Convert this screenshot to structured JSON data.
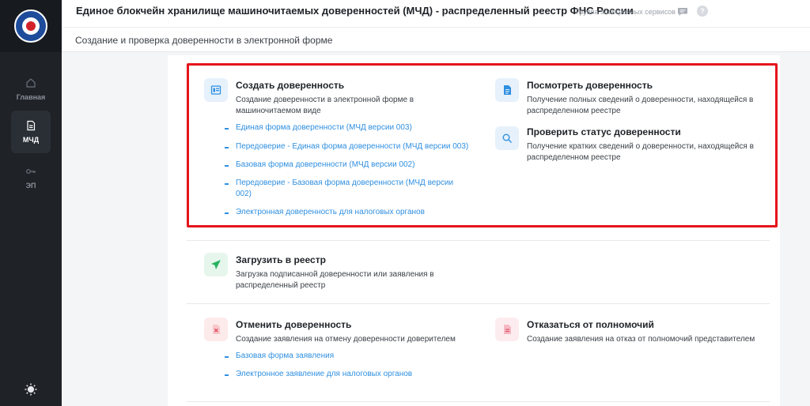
{
  "colors": {
    "accent": "#2f8fe0",
    "highlight": "#e5141b",
    "sidebar_bg": "#1f2328"
  },
  "sidebar": {
    "items": [
      {
        "label": "Главная",
        "icon": "home-icon"
      },
      {
        "label": "МЧД",
        "icon": "document-icon",
        "active": true
      },
      {
        "label": "ЭП",
        "icon": "key-icon"
      }
    ],
    "theme_toggle_icon": "sun-icon"
  },
  "header": {
    "title": "Единое блокчейн хранилище машиночитаемых доверенностей (МЧД) - распределенный реестр ФНС России",
    "group_link": "Группа электронных сервисов"
  },
  "page_title": "Создание и проверка доверенности в электронной форме",
  "create": {
    "title": "Создать доверенность",
    "description": "Создание доверенности в электронной форме в машиночитаемом виде",
    "links": [
      "Единая форма доверенности (МЧД версии 003)",
      "Передоверие - Единая форма доверенности (МЧД версии 003)",
      "Базовая форма доверенности (МЧД версии 002)",
      "Передоверие - Базовая форма доверенности (МЧД версии 002)",
      "Электронная доверенность для налоговых органов"
    ]
  },
  "view": {
    "title": "Посмотреть доверенность",
    "description": "Получение полных сведений о доверенности, находящейся в распределенном реестре"
  },
  "check": {
    "title": "Проверить статус доверенности",
    "description": "Получение кратких сведений о доверенности, находящейся в распределенном реестре"
  },
  "upload": {
    "title": "Загрузить в реестр",
    "description": "Загрузка подписанной доверенности или заявления в распределенный реестр"
  },
  "cancel": {
    "title": "Отменить доверенность",
    "description": "Создание заявления на отмену доверенности доверителем",
    "links": [
      "Базовая форма заявления",
      "Электронное заявление для налоговых органов"
    ]
  },
  "refuse": {
    "title": "Отказаться от полномочий",
    "description": "Создание заявления на отказ от полномочий представителем"
  }
}
